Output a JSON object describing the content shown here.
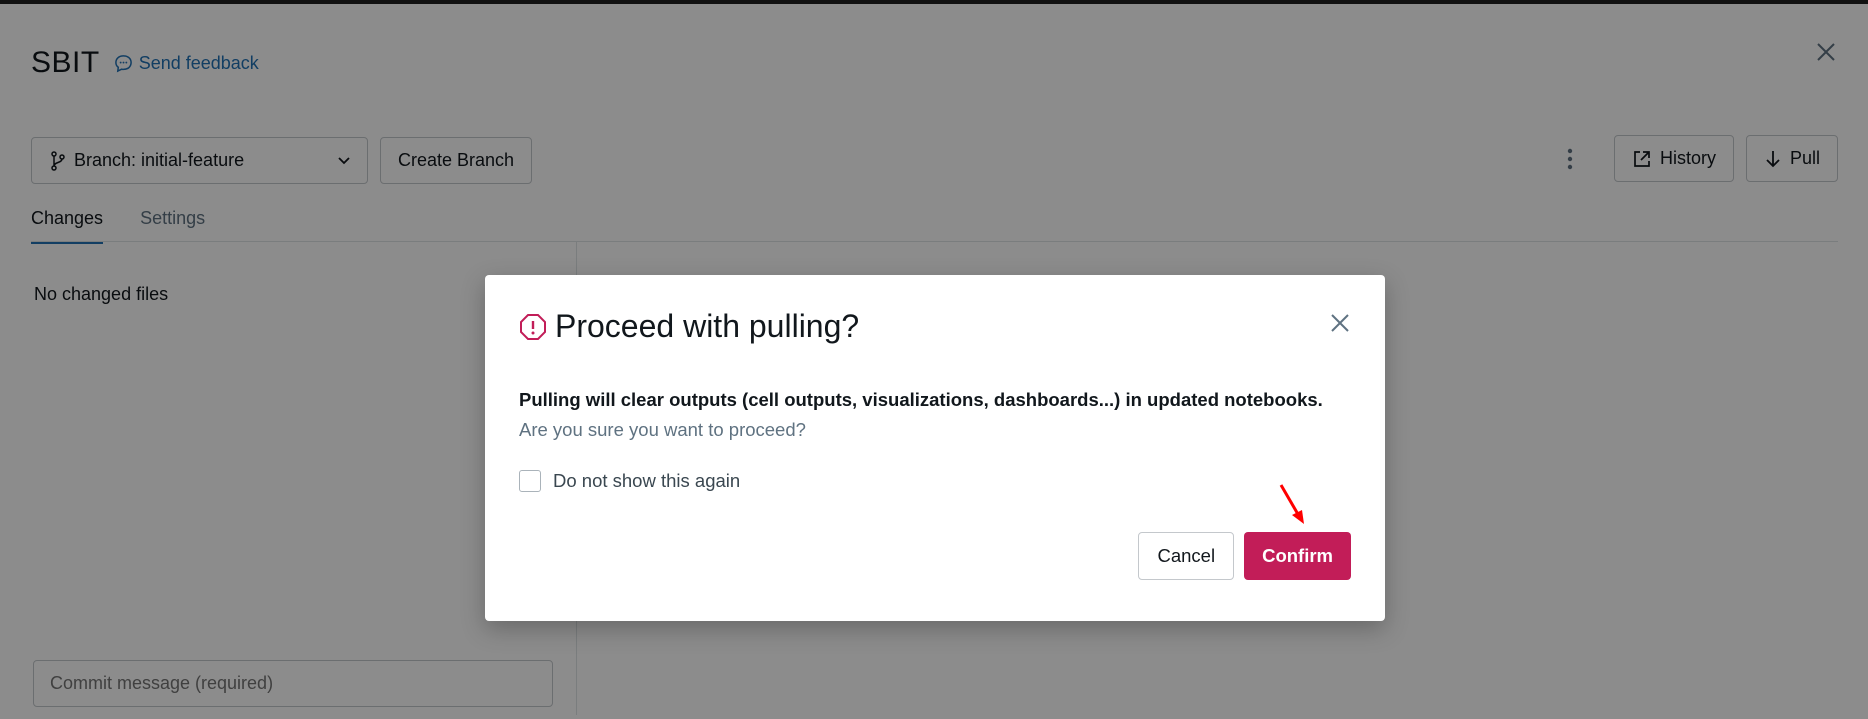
{
  "header": {
    "title": "SBIT",
    "feedback_label": "Send feedback"
  },
  "toolbar": {
    "branch_label": "Branch: initial-feature",
    "create_branch_label": "Create Branch",
    "history_label": "History",
    "pull_label": "Pull"
  },
  "tabs": [
    {
      "label": "Changes",
      "active": true
    },
    {
      "label": "Settings",
      "active": false
    }
  ],
  "changes": {
    "empty_text": "No changed files",
    "commit_placeholder": "Commit message (required)"
  },
  "modal": {
    "title": "Proceed with pulling?",
    "body_strong": "Pulling will clear outputs (cell outputs, visualizations, dashboards...) in updated notebooks.",
    "body_rest": " Are you sure you want to proceed?",
    "checkbox_label": "Do not show this again",
    "cancel_label": "Cancel",
    "confirm_label": "Confirm"
  },
  "colors": {
    "accent": "#2272b4",
    "danger": "#c21d58",
    "annotation_arrow": "#ff0000"
  }
}
